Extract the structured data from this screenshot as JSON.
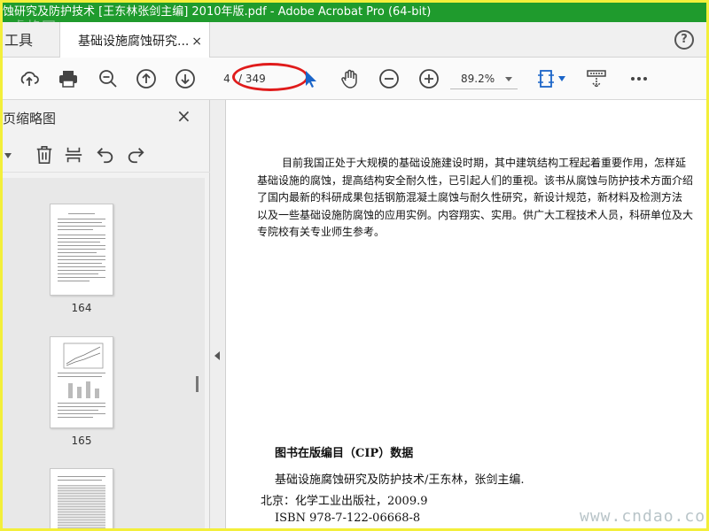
{
  "window": {
    "title": "蚀研究及防护技术 [王东林张剑主编] 2010年版.pdf - Adobe Acrobat Pro (64-bit)",
    "watermark_top": "睿格网"
  },
  "tabs": {
    "tools_label": "工具",
    "doc_label": "基础设施腐蚀研究...",
    "close_glyph": "×",
    "help_glyph": "?"
  },
  "toolbar": {
    "page_current": "4",
    "page_total": "/ 349",
    "zoom": "89.2%",
    "icons": [
      "upload-icon",
      "print-icon",
      "zoom-out-search-icon",
      "page-up-icon",
      "page-down-icon",
      "select-arrow-icon",
      "hand-icon",
      "zoom-minus-icon",
      "zoom-plus-icon",
      "fit-page-icon",
      "scroll-mode-icon",
      "more-icon"
    ],
    "accent_color": "#1a64c8",
    "highlight_color": "#e01b1b"
  },
  "left_panel": {
    "title": "页缩略图",
    "close_glyph": "×",
    "tool_icons": [
      "options-icon",
      "trash-icon",
      "page-insert-icon",
      "undo-icon",
      "redo-icon"
    ],
    "thumbnails": [
      {
        "label": "164"
      },
      {
        "label": "165"
      },
      {
        "label": ""
      }
    ]
  },
  "document": {
    "intro_lines": [
      "目前我国正处于大规模的基础设施建设时期，其中建筑结构工程起着重要作用，怎样延",
      "基础设施的腐蚀，提高结构安全耐久性，已引起人们的重视。该书从腐蚀与防护技术方面介绍",
      "了国内最新的科研成果包括钢筋混凝土腐蚀与耐久性研究，新设计规范，新材料及检测方法",
      "以及一些基础设施防腐蚀的应用实例。内容翔实、实用。供广大工程技术人员，科研单位及大",
      "专院校有关专业师生参考。"
    ],
    "cip_heading": "图书在版编目（CIP）数据",
    "cip_line1": "基础设施腐蚀研究及防护技术/王东林，张剑主编.",
    "cip_line2": "北京：化学工业出版社，2009.9",
    "cip_line3": "ISBN 978-7-122-06668-8",
    "watermark_bottom": "www.cndao.com"
  }
}
